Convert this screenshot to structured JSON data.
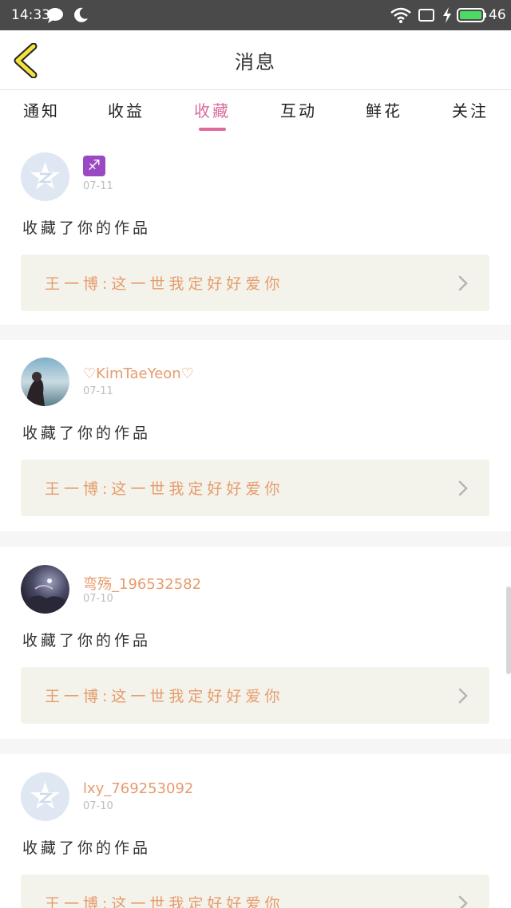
{
  "status_bar": {
    "time": "14:33",
    "battery": "46"
  },
  "header": {
    "title": "消息"
  },
  "tabs": [
    {
      "label": "通知"
    },
    {
      "label": "收益"
    },
    {
      "label": "收藏"
    },
    {
      "label": "互动"
    },
    {
      "label": "鲜花"
    },
    {
      "label": "关注"
    }
  ],
  "active_tab": "收藏",
  "messages": [
    {
      "username": "♐",
      "date": "07-11",
      "action": "收藏了你的作品",
      "work_title": "王一博:这一世我定好好爱你",
      "avatar": "default-qq-avatar"
    },
    {
      "username": "♡KimTaeYeon♡",
      "date": "07-11",
      "action": "收藏了你的作品",
      "work_title": "王一博:这一世我定好好爱你",
      "avatar": "photo-avatar"
    },
    {
      "username": "弯殇_196532582",
      "date": "07-10",
      "action": "收藏了你的作品",
      "work_title": "王一博:这一世我定好好爱你",
      "avatar": "night-sky-avatar"
    },
    {
      "username": "lxy_769253092",
      "date": "07-10",
      "action": "收藏了你的作品",
      "work_title": "王一博:这一世我定好好爱你",
      "avatar": "default-qq-avatar"
    }
  ],
  "colors": {
    "accent": "#e16a9a",
    "username": "#e79b6c",
    "work_bg": "#f3f3eb"
  }
}
